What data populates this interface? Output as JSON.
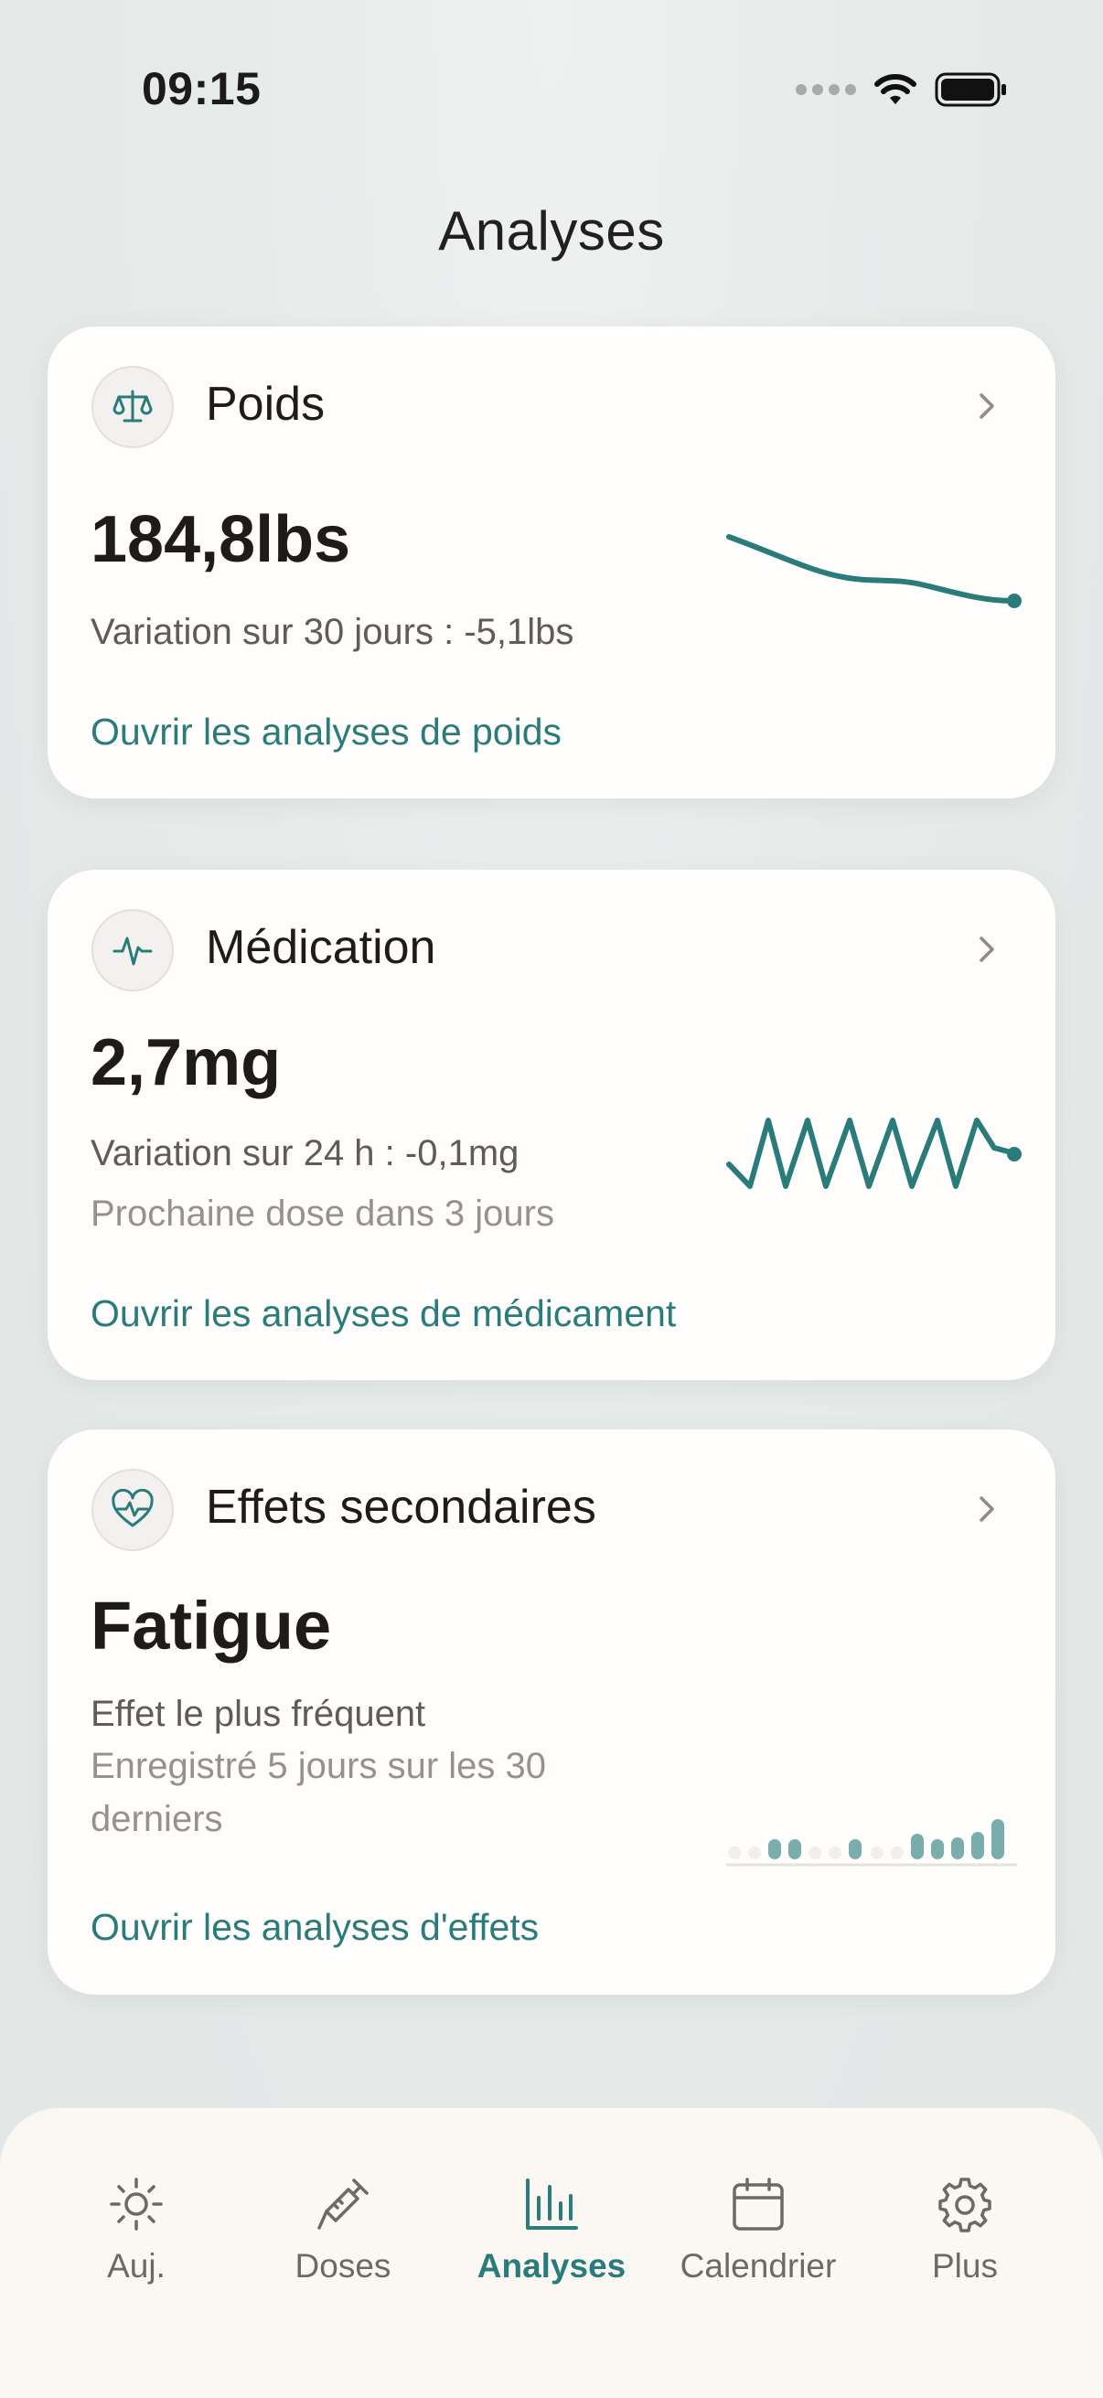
{
  "status": {
    "time": "09:15"
  },
  "page": {
    "title": "Analyses"
  },
  "weight_card": {
    "title": "Poids",
    "value": "184,8lbs",
    "variation": "Variation sur 30 jours : -5,1lbs",
    "link": "Ouvrir les analyses de poids",
    "icon": "scale-icon"
  },
  "medication_card": {
    "title": "Médication",
    "value": "2,7mg",
    "variation": "Variation sur 24 h : -0,1mg",
    "next_dose": "Prochaine dose dans 3 jours",
    "link": "Ouvrir les analyses de médicament",
    "icon": "pulse-icon"
  },
  "side_effects_card": {
    "title": "Effets secondaires",
    "value": "Fatigue",
    "subtitle": "Effet le plus fréquent",
    "recorded": "Enregistré 5 jours sur les 30 derniers",
    "link": "Ouvrir les analyses d'effets",
    "icon": "heart-pulse-icon"
  },
  "tabs": [
    {
      "label": "Auj.",
      "icon": "sun-icon",
      "active": false
    },
    {
      "label": "Doses",
      "icon": "syringe-icon",
      "active": false
    },
    {
      "label": "Analyses",
      "icon": "bar-chart-icon",
      "active": true
    },
    {
      "label": "Calendrier",
      "icon": "calendar-icon",
      "active": false
    },
    {
      "label": "Plus",
      "icon": "gear-icon",
      "active": false
    }
  ],
  "colors": {
    "accent": "#2a7c7b",
    "background": "#e7ebea",
    "card": "#fffefd",
    "tabbar": "#fbf8f3"
  }
}
